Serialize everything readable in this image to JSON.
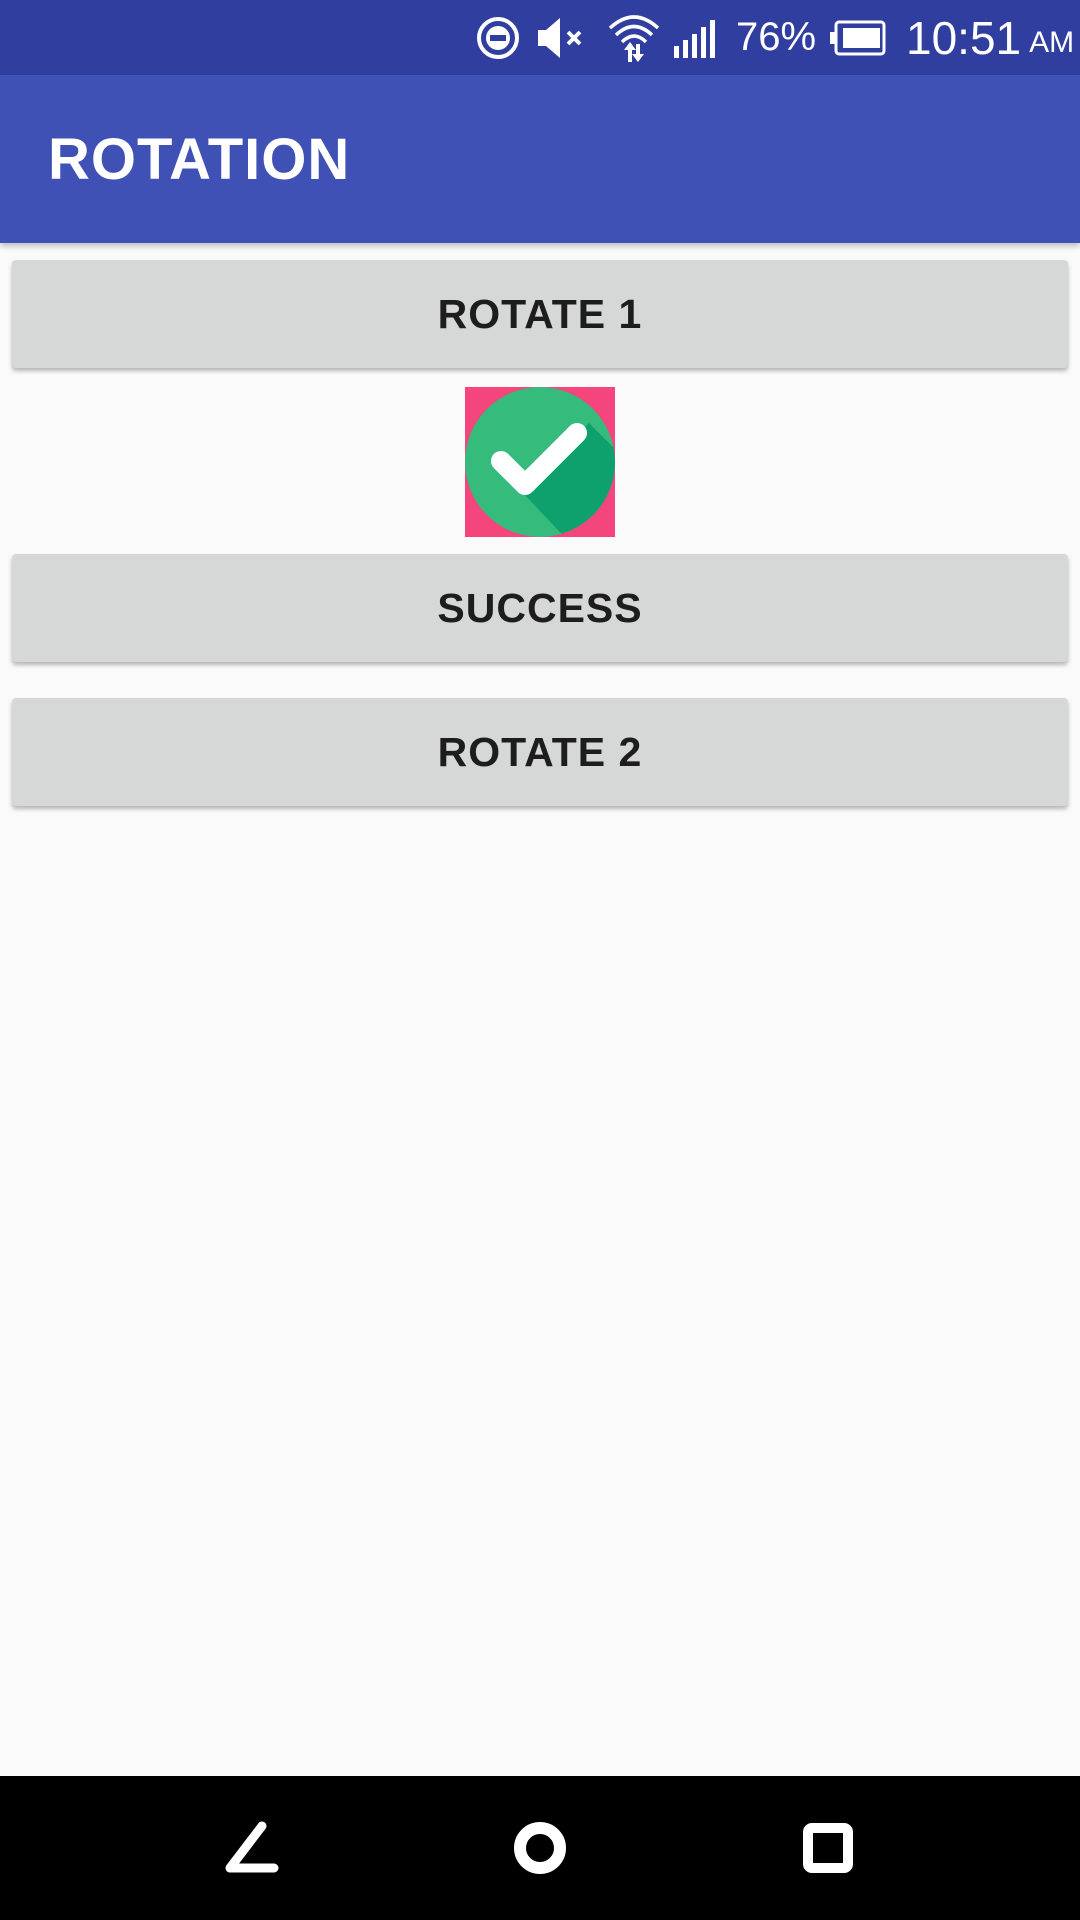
{
  "status_bar": {
    "battery_percent": "76%",
    "time": "10:51",
    "ampm": "AM",
    "icons": [
      "do-not-disturb-icon",
      "volume-muted-icon",
      "wifi-icon",
      "signal-icon",
      "battery-icon"
    ]
  },
  "app_bar": {
    "title": "ROTATION",
    "color": "#3f51b5"
  },
  "main": {
    "rotate1_label": "ROTATE 1",
    "success_label": "SUCCESS",
    "rotate2_label": "ROTATE 2",
    "image": {
      "icon": "check-circle-icon",
      "background_color": "#f4467c",
      "circle_color": "#35bb7c"
    }
  },
  "nav_bar": {
    "icons": [
      "back-icon",
      "home-icon",
      "recents-icon"
    ]
  }
}
